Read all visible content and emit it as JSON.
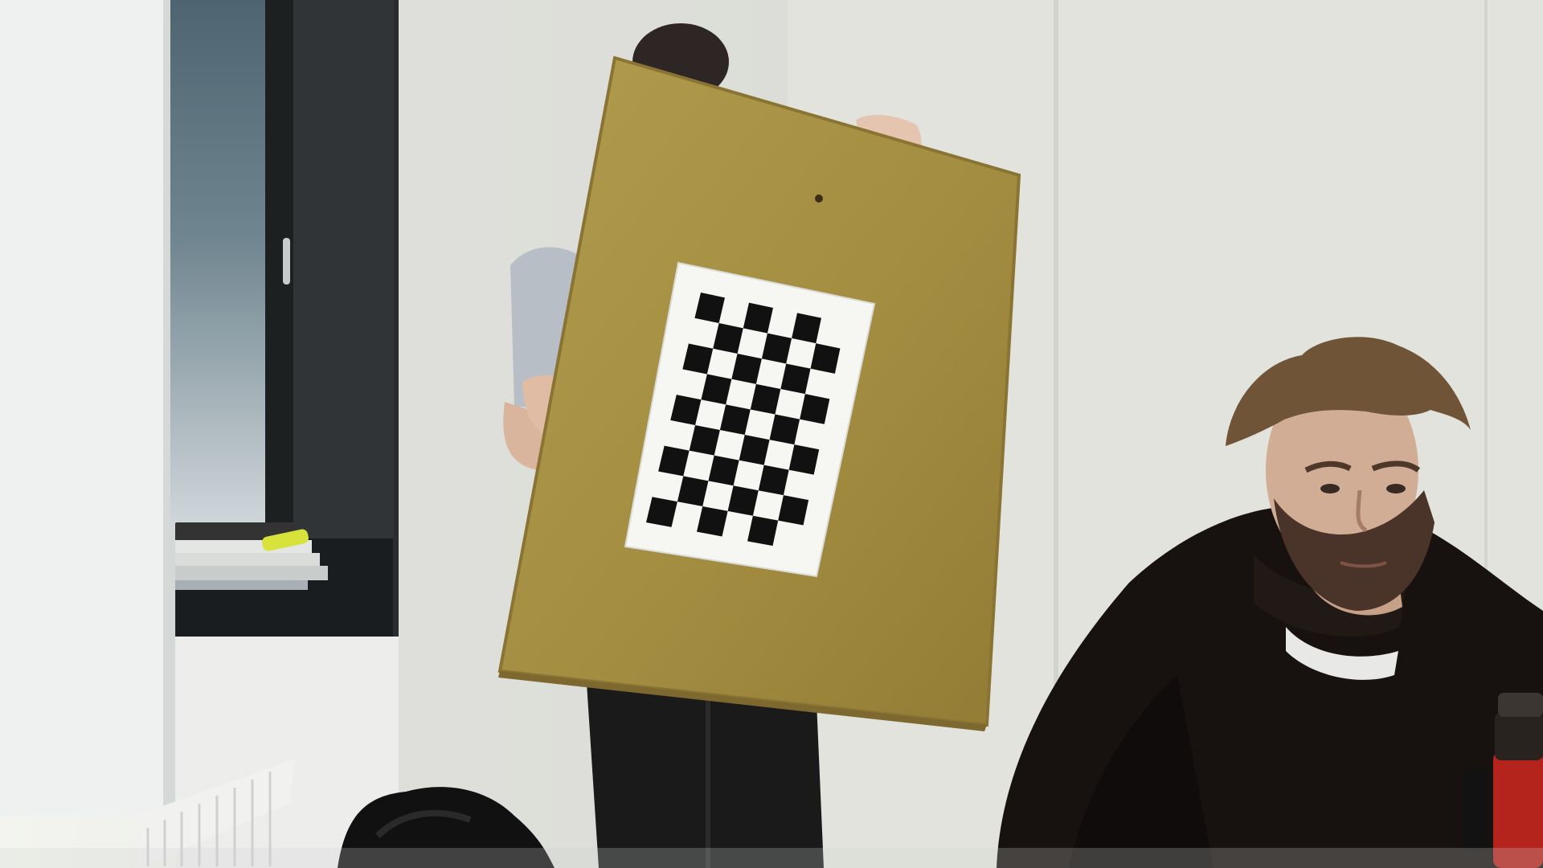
{
  "scene": {
    "kind": "photo",
    "setting": "office-room",
    "subjects": [
      "person-holding-board",
      "seated-man"
    ],
    "objects": [
      "window",
      "blind",
      "books",
      "radiator",
      "bag",
      "thermos",
      "calibration-board",
      "checkerboard-pattern"
    ]
  },
  "checkerboard": {
    "columns": 6,
    "rows": 9
  },
  "colors": {
    "wall": "#e3e4df",
    "wall_shadow": "#c9ccc7",
    "board": "#a68f43",
    "paper": "#f6f6f3",
    "square": "#111111",
    "hoodie": "#17120f",
    "thermos": "#b5231d",
    "window_frame": "#1f2223"
  }
}
